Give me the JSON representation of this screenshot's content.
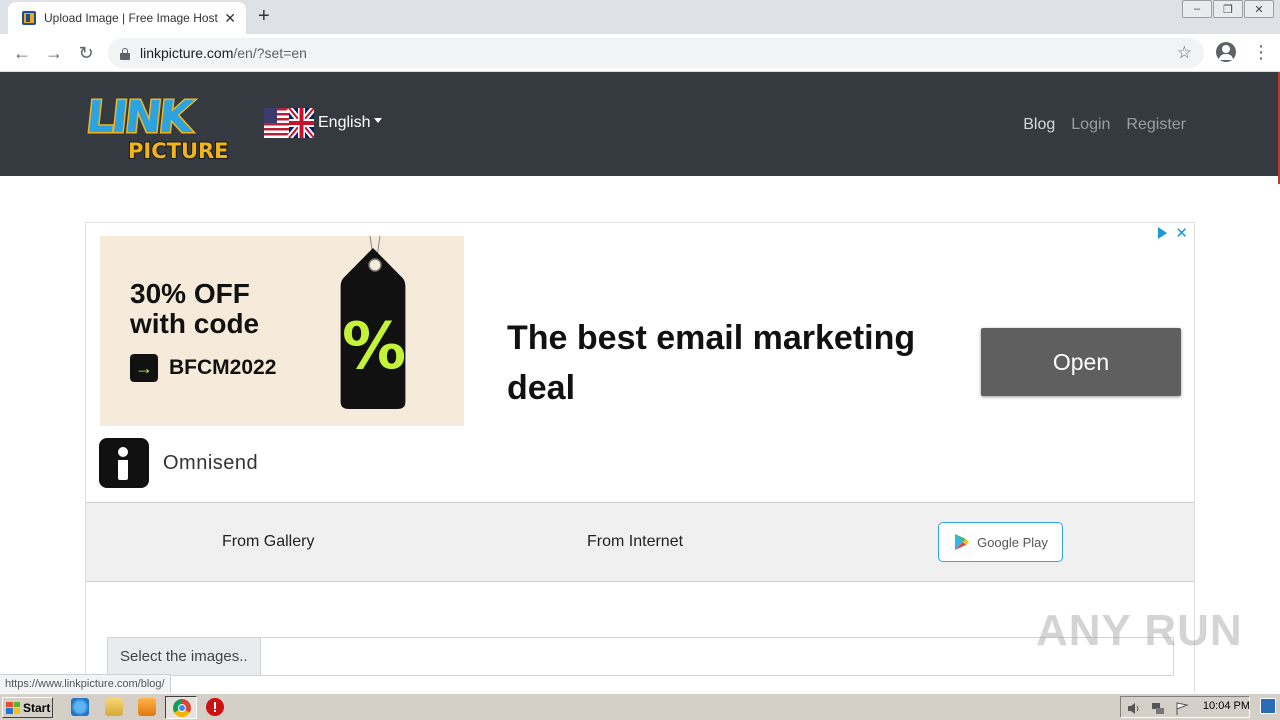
{
  "browser": {
    "tab_title": "Upload Image | Free Image Hosting",
    "new_tab_symbol": "+",
    "url_host": "linkpicture.com",
    "url_path": "/en/?set=en",
    "window_controls": [
      "–",
      "❐",
      "✕"
    ]
  },
  "site": {
    "logo_text_top": "LINK",
    "logo_text_bottom": "PICTURE",
    "language": "English",
    "nav": [
      "Blog",
      "Login",
      "Register"
    ]
  },
  "ad": {
    "banner_line1": "30% OFF",
    "banner_line2": "with code",
    "banner_code": "BFCM2022",
    "tag_symbol": "%",
    "headline": "The best email marketing deal",
    "cta": "Open",
    "advertiser": "Omnisend",
    "colors": {
      "banner_bg": "#f6ebdb",
      "lime": "#c4f43a",
      "adchoice": "#1a9ad6"
    }
  },
  "upload": {
    "from_gallery": "From Gallery",
    "from_internet": "From Internet",
    "google_play": "Google Play",
    "file_button": "Select the images.."
  },
  "status_url": "https://www.linkpicture.com/blog/",
  "watermark": "ANY RUN",
  "taskbar": {
    "start": "Start",
    "clock": "10:04 PM"
  }
}
